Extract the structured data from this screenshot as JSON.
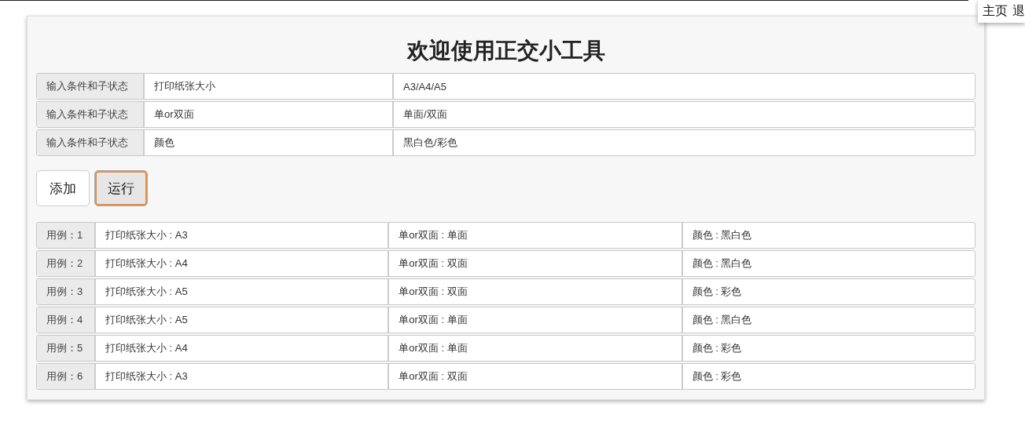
{
  "top_menu": [
    "主页",
    "退"
  ],
  "title": "欢迎使用正交小工具",
  "conditions": [
    {
      "label": "输入条件和子状态",
      "name": "打印纸张大小",
      "states": "A3/A4/A5"
    },
    {
      "label": "输入条件和子状态",
      "name": "单or双面",
      "states": "单面/双面"
    },
    {
      "label": "输入条件和子状态",
      "name": "颜色",
      "states": "黑白色/彩色"
    }
  ],
  "buttons": [
    {
      "label": "添加",
      "focused": false
    },
    {
      "label": "运行",
      "focused": true
    }
  ],
  "cases": [
    {
      "label": "用例：1",
      "cells": [
        "打印纸张大小 : A3",
        "单or双面 : 单面",
        "颜色 : 黑白色"
      ]
    },
    {
      "label": "用例：2",
      "cells": [
        "打印纸张大小 : A4",
        "单or双面 : 双面",
        "颜色 : 黑白色"
      ]
    },
    {
      "label": "用例：3",
      "cells": [
        "打印纸张大小 : A5",
        "单or双面 : 双面",
        "颜色 : 彩色"
      ]
    },
    {
      "label": "用例：4",
      "cells": [
        "打印纸张大小 : A5",
        "单or双面 : 单面",
        "颜色 : 黑白色"
      ]
    },
    {
      "label": "用例：5",
      "cells": [
        "打印纸张大小 : A4",
        "单or双面 : 单面",
        "颜色 : 彩色"
      ]
    },
    {
      "label": "用例：6",
      "cells": [
        "打印纸张大小 : A3",
        "单or双面 : 双面",
        "颜色 : 彩色"
      ]
    }
  ]
}
